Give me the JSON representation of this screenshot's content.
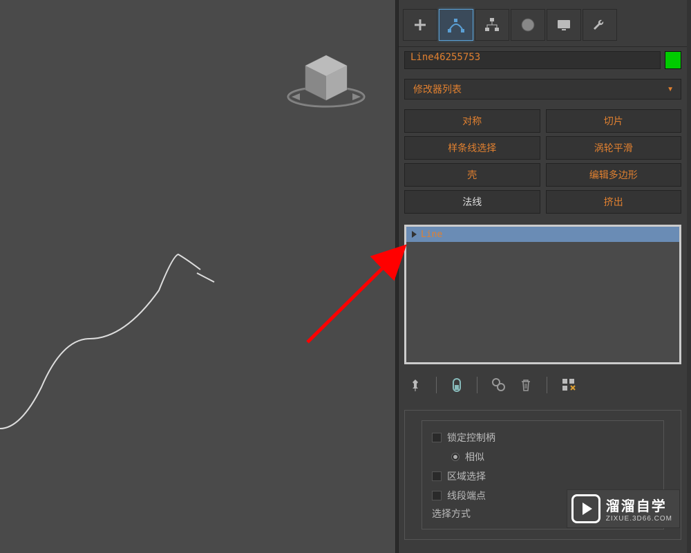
{
  "object_name": "Line46255753",
  "object_color": "#00cc00",
  "modifier_dropdown": {
    "label": "修改器列表"
  },
  "modifiers": [
    {
      "label": "对称",
      "active": true
    },
    {
      "label": "切片",
      "active": true
    },
    {
      "label": "样条线选择",
      "active": true
    },
    {
      "label": "涡轮平滑",
      "active": true
    },
    {
      "label": "壳",
      "active": true
    },
    {
      "label": "编辑多边形",
      "active": true
    },
    {
      "label": "法线",
      "active": false
    },
    {
      "label": "挤出",
      "active": true
    }
  ],
  "stack": {
    "item_label": "Line"
  },
  "rollout": {
    "lock_handles": "锁定控制柄",
    "similar": "相似",
    "area_select": "区域选择",
    "segment_end": "线段端点",
    "select_method": "选择方式"
  },
  "watermark": {
    "title": "溜溜自学",
    "url": "ZIXUE.3D66.COM"
  }
}
